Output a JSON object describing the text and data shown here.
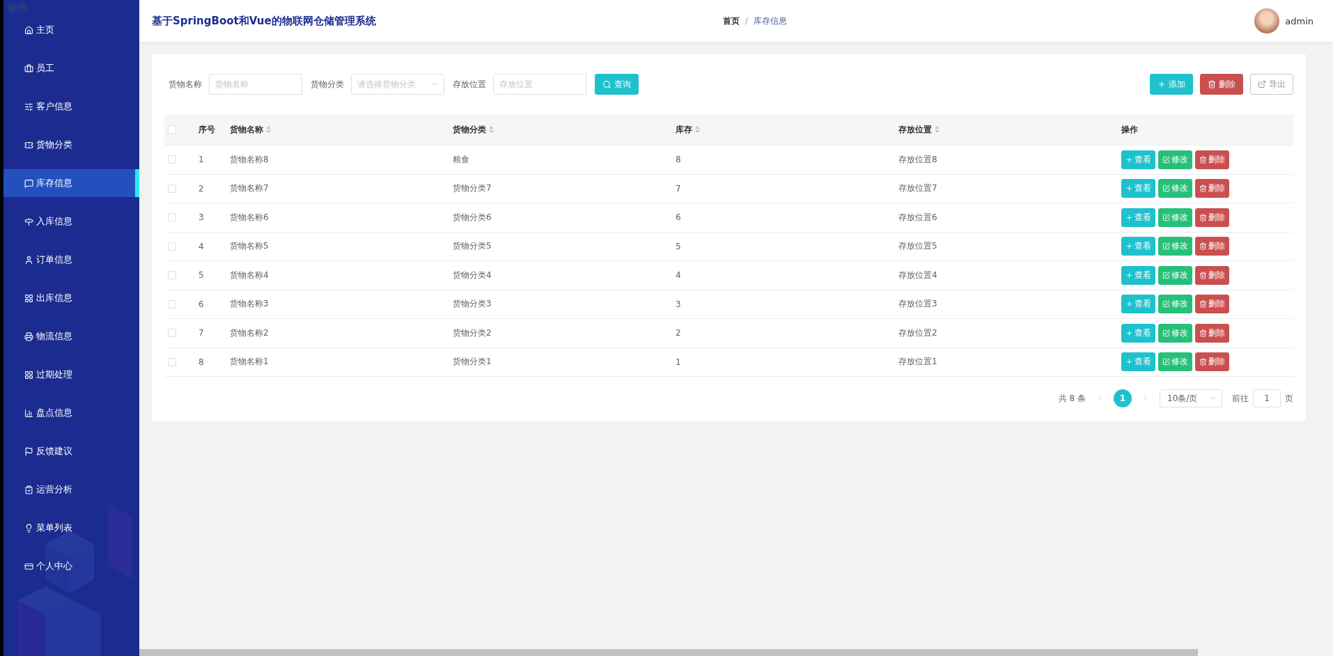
{
  "overlay_label": "暂停",
  "sidebar": {
    "items": [
      {
        "label": "主页",
        "selected": false
      },
      {
        "label": "员工",
        "selected": false
      },
      {
        "label": "客户信息",
        "selected": false
      },
      {
        "label": "货物分类",
        "selected": false
      },
      {
        "label": "库存信息",
        "selected": true
      },
      {
        "label": "入库信息",
        "selected": false
      },
      {
        "label": "订单信息",
        "selected": false
      },
      {
        "label": "出库信息",
        "selected": false
      },
      {
        "label": "物流信息",
        "selected": false
      },
      {
        "label": "过期处理",
        "selected": false
      },
      {
        "label": "盘点信息",
        "selected": false
      },
      {
        "label": "反馈建议",
        "selected": false
      },
      {
        "label": "运营分析",
        "selected": false
      },
      {
        "label": "菜单列表",
        "selected": false
      },
      {
        "label": "个人中心",
        "selected": false
      }
    ]
  },
  "header": {
    "title": "基于SpringBoot和Vue的物联网仓储管理系统",
    "breadcrumb": [
      "首页",
      "库存信息"
    ],
    "separator": "/",
    "user": "admin"
  },
  "filters": [
    {
      "label": "货物名称",
      "placeholder": "货物名称",
      "kind": "input"
    },
    {
      "label": "货物分类",
      "placeholder": "请选择货物分类",
      "kind": "select"
    },
    {
      "label": "存放位置",
      "placeholder": "存放位置",
      "kind": "input"
    }
  ],
  "search_button": "查询",
  "toolbar_buttons": [
    {
      "label": "添加",
      "kind": "add"
    },
    {
      "label": "删除",
      "kind": "delete"
    },
    {
      "label": "导出",
      "kind": "export"
    }
  ],
  "table": {
    "header_checked": false,
    "columns": [
      {
        "label": "序号",
        "sortable": false
      },
      {
        "label": "货物名称",
        "sortable": true
      },
      {
        "label": "货物分类",
        "sortable": true
      },
      {
        "label": "库存",
        "sortable": true
      },
      {
        "label": "存放位置",
        "sortable": true
      },
      {
        "label": "操作",
        "sortable": false
      }
    ],
    "rows": [
      {
        "checked": false,
        "cells": [
          "1",
          "货物名称8",
          "粮食",
          "8",
          "存放位置8"
        ],
        "actions": [
          {
            "label": "查看",
            "kind": "view"
          },
          {
            "label": "修改",
            "kind": "edit"
          },
          {
            "label": "删除",
            "kind": "delete"
          }
        ]
      },
      {
        "checked": false,
        "cells": [
          "2",
          "货物名称7",
          "货物分类7",
          "7",
          "存放位置7"
        ],
        "actions": [
          {
            "label": "查看",
            "kind": "view"
          },
          {
            "label": "修改",
            "kind": "edit"
          },
          {
            "label": "删除",
            "kind": "delete"
          }
        ]
      },
      {
        "checked": false,
        "cells": [
          "3",
          "货物名称6",
          "货物分类6",
          "6",
          "存放位置6"
        ],
        "actions": [
          {
            "label": "查看",
            "kind": "view"
          },
          {
            "label": "修改",
            "kind": "edit"
          },
          {
            "label": "删除",
            "kind": "delete"
          }
        ]
      },
      {
        "checked": false,
        "cells": [
          "4",
          "货物名称5",
          "货物分类5",
          "5",
          "存放位置5"
        ],
        "actions": [
          {
            "label": "查看",
            "kind": "view"
          },
          {
            "label": "修改",
            "kind": "edit"
          },
          {
            "label": "删除",
            "kind": "delete"
          }
        ]
      },
      {
        "checked": false,
        "cells": [
          "5",
          "货物名称4",
          "货物分类4",
          "4",
          "存放位置4"
        ],
        "actions": [
          {
            "label": "查看",
            "kind": "view"
          },
          {
            "label": "修改",
            "kind": "edit"
          },
          {
            "label": "删除",
            "kind": "delete"
          }
        ]
      },
      {
        "checked": false,
        "cells": [
          "6",
          "货物名称3",
          "货物分类3",
          "3",
          "存放位置3"
        ],
        "actions": [
          {
            "label": "查看",
            "kind": "view"
          },
          {
            "label": "修改",
            "kind": "edit"
          },
          {
            "label": "删除",
            "kind": "delete"
          }
        ]
      },
      {
        "checked": false,
        "cells": [
          "7",
          "货物名称2",
          "货物分类2",
          "2",
          "存放位置2"
        ],
        "actions": [
          {
            "label": "查看",
            "kind": "view"
          },
          {
            "label": "修改",
            "kind": "edit"
          },
          {
            "label": "删除",
            "kind": "delete"
          }
        ]
      },
      {
        "checked": false,
        "cells": [
          "8",
          "货物名称1",
          "货物分类1",
          "1",
          "存放位置1"
        ],
        "actions": [
          {
            "label": "查看",
            "kind": "view"
          },
          {
            "label": "修改",
            "kind": "edit"
          },
          {
            "label": "删除",
            "kind": "delete"
          }
        ]
      }
    ]
  },
  "pagination": {
    "total": "共 8 条",
    "pages": [
      {
        "label": "1",
        "selected": true
      }
    ],
    "page_size": "10条/页",
    "goto_label": "前往",
    "goto_value": "1",
    "goto_suffix": "页"
  }
}
